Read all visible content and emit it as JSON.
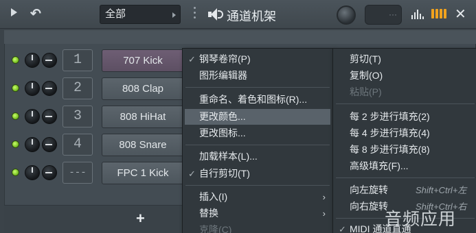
{
  "toolbar": {
    "filter_value": "全部",
    "window_title": "通道机架",
    "swing_value": "···"
  },
  "channels": [
    {
      "mixer": "1",
      "name": "707 Kick",
      "selected": true
    },
    {
      "mixer": "2",
      "name": "808 Clap",
      "selected": false
    },
    {
      "mixer": "3",
      "name": "808 HiHat",
      "selected": false
    },
    {
      "mixer": "4",
      "name": "808 Snare",
      "selected": false
    },
    {
      "mixer": "---",
      "name": "FPC 1 Kick",
      "selected": false
    }
  ],
  "add_button": "+",
  "context_menu": {
    "items": [
      {
        "label": "钢琴卷帘(P)",
        "checked": true
      },
      {
        "label": "图形编辑器"
      },
      {
        "label": "重命名、着色和图标(R)..."
      },
      {
        "label": "更改颜色...",
        "highlighted": true
      },
      {
        "label": "更改图标..."
      },
      {
        "label": "加载样本(L)..."
      },
      {
        "label": "自行剪切(T)",
        "checked": true
      },
      {
        "label": "插入(I)",
        "submenu": true
      },
      {
        "label": "替换",
        "submenu": true
      },
      {
        "label": "克隆(C)",
        "disabled": true
      }
    ]
  },
  "submenu": {
    "items": [
      {
        "label": "剪切(T)"
      },
      {
        "label": "复制(O)"
      },
      {
        "label": "粘贴(P)",
        "disabled": true
      },
      {
        "label": "每 2 步进行填充(2)"
      },
      {
        "label": "每 4 步进行填充(4)"
      },
      {
        "label": "每 8 步进行填充(8)"
      },
      {
        "label": "高级填充(F)..."
      },
      {
        "label": "向左旋转",
        "shortcut": "Shift+Ctrl+左"
      },
      {
        "label": "向右旋转",
        "shortcut": "Shift+Ctrl+右"
      },
      {
        "label": "MIDI 通道直通",
        "checked": true
      }
    ]
  },
  "watermark": "音频应用"
}
